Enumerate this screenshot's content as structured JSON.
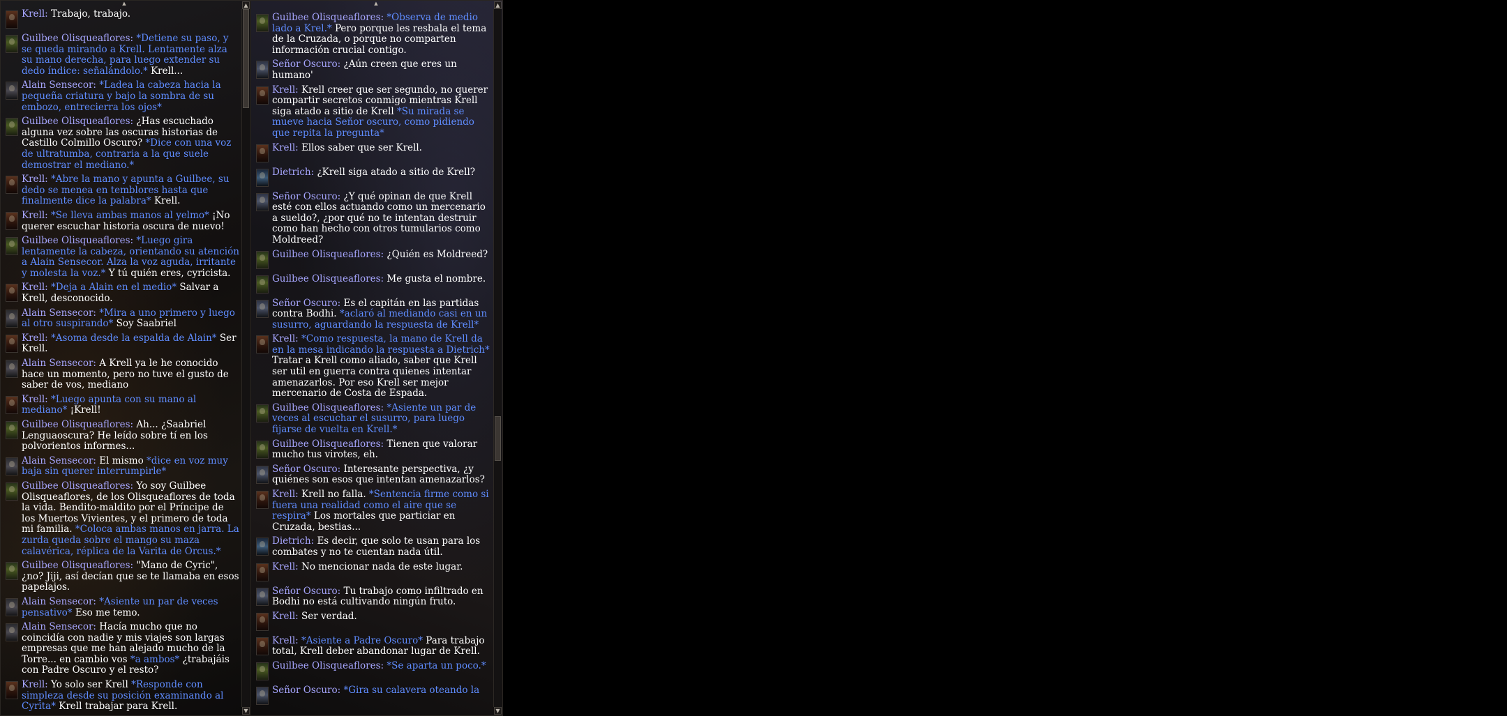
{
  "left_panel": {
    "messages": [
      {
        "speaker": "Krell:",
        "portrait": "krell",
        "parts": [
          {
            "t": "txt",
            "v": "Trabajo, trabajo."
          }
        ]
      },
      {
        "speaker": "Guilbee Olisqueaflores:",
        "portrait": "guilbee",
        "parts": [
          {
            "t": "em",
            "v": "*Detiene su paso, y se queda mirando a Krell. Lentamente alza su mano derecha, para luego extender su dedo índice: señalándolo.*"
          },
          {
            "t": "txt",
            "v": "Krell..."
          }
        ]
      },
      {
        "speaker": "Alain Sensecor:",
        "portrait": "alain",
        "parts": [
          {
            "t": "em",
            "v": "*Ladea la cabeza hacia la pequeña criatura y bajo la sombra de su embozo, entrecierra los ojos*"
          }
        ]
      },
      {
        "speaker": "Guilbee Olisqueaflores:",
        "portrait": "guilbee",
        "parts": [
          {
            "t": "txt",
            "v": "¿Has escuchado alguna vez sobre las oscuras historias de Castillo Colmillo Oscuro?"
          },
          {
            "t": "em",
            "v": "*Dice con una voz de ultratumba, contraria a la que suele demostrar el mediano.*"
          }
        ]
      },
      {
        "speaker": "Krell:",
        "portrait": "krell",
        "parts": [
          {
            "t": "em",
            "v": "*Abre la mano y apunta a Guilbee, su dedo se menea en temblores hasta que finalmente dice la palabra*"
          },
          {
            "t": "txt",
            "v": "Krell."
          }
        ]
      },
      {
        "speaker": "Krell:",
        "portrait": "krell",
        "parts": [
          {
            "t": "em",
            "v": "*Se lleva ambas manos al yelmo*"
          },
          {
            "t": "txt",
            "v": "¡No querer escuchar historia oscura de nuevo!"
          }
        ]
      },
      {
        "speaker": "Guilbee Olisqueaflores:",
        "portrait": "guilbee",
        "parts": [
          {
            "t": "em",
            "v": "*Luego gira lentamente la cabeza, orientando su atención a Alain Sensecor. Alza la voz aguda, irritante y molesta la voz.*"
          },
          {
            "t": "txt",
            "v": "Y tú quién eres, cyricista."
          }
        ]
      },
      {
        "speaker": "Krell:",
        "portrait": "krell",
        "parts": [
          {
            "t": "em",
            "v": "*Deja a Alain en el medio*"
          },
          {
            "t": "txt",
            "v": "Salvar a Krell, desconocido."
          }
        ]
      },
      {
        "speaker": "Alain Sensecor:",
        "portrait": "alain",
        "parts": [
          {
            "t": "em",
            "v": "*Mira a uno primero y luego al otro suspirando*"
          },
          {
            "t": "txt",
            "v": "Soy Saabriel"
          }
        ]
      },
      {
        "speaker": "Krell:",
        "portrait": "krell",
        "parts": [
          {
            "t": "em",
            "v": "*Asoma desde la espalda de Alain*"
          },
          {
            "t": "txt",
            "v": "Ser Krell."
          }
        ]
      },
      {
        "speaker": "Alain Sensecor:",
        "portrait": "alain",
        "parts": [
          {
            "t": "txt",
            "v": "A Krell ya le he conocido hace un momento, pero no tuve el gusto de saber de vos, mediano"
          }
        ]
      },
      {
        "speaker": "Krell:",
        "portrait": "krell",
        "parts": [
          {
            "t": "em",
            "v": "*Luego apunta con su mano al mediano*"
          },
          {
            "t": "txt",
            "v": "¡Krell!"
          }
        ]
      },
      {
        "speaker": "Guilbee Olisqueaflores:",
        "portrait": "guilbee",
        "parts": [
          {
            "t": "txt",
            "v": "Ah... ¿Saabriel Lenguaoscura? He leído sobre tí en los polvorientos informes..."
          }
        ]
      },
      {
        "speaker": "Alain Sensecor:",
        "portrait": "alain",
        "parts": [
          {
            "t": "txt",
            "v": "El mismo"
          },
          {
            "t": "em",
            "v": "*dice en voz muy baja sin querer interrumpirle*"
          }
        ]
      },
      {
        "speaker": "Guilbee Olisqueaflores:",
        "portrait": "guilbee",
        "parts": [
          {
            "t": "txt",
            "v": "Yo soy Guilbee Olisqueaflores, de los Olisqueaflores de toda la vida. Bendito-maldito por el Príncipe de los Muertos Vivientes, y el primero de toda mi familia."
          },
          {
            "t": "em",
            "v": "*Coloca ambas manos en jarra. La zurda queda sobre el mango su maza calavérica, réplica de la Varita de Orcus.*"
          }
        ]
      },
      {
        "speaker": "Guilbee Olisqueaflores:",
        "portrait": "guilbee",
        "parts": [
          {
            "t": "txt",
            "v": "\"Mano de Cyric\", ¿no? Jiji, así decían que se te llamaba en esos papelajos."
          }
        ]
      },
      {
        "speaker": "Alain Sensecor:",
        "portrait": "alain",
        "parts": [
          {
            "t": "em",
            "v": "*Asiente un par de veces pensativo*"
          },
          {
            "t": "txt",
            "v": "Eso me temo."
          }
        ]
      },
      {
        "speaker": "Alain Sensecor:",
        "portrait": "alain",
        "parts": [
          {
            "t": "txt",
            "v": "Hacía mucho que no coincidía con nadie y mis viajes son largas empresas que me han alejado mucho de la Torre... en cambio vos"
          },
          {
            "t": "em",
            "v": "*a ambos*"
          },
          {
            "t": "txt",
            "v": "¿trabajáis con Padre Oscuro y el resto?"
          }
        ]
      },
      {
        "speaker": "Krell:",
        "portrait": "krell",
        "parts": [
          {
            "t": "txt",
            "v": "Yo solo ser Krell"
          },
          {
            "t": "em",
            "v": "*Responde con simpleza desde su posición examinando al Cyrita*"
          },
          {
            "t": "txt",
            "v": "Krell trabajar para Krell."
          }
        ]
      }
    ]
  },
  "right_panel": {
    "messages": [
      {
        "speaker": "Guilbee Olisqueaflores:",
        "portrait": "guilbee",
        "parts": [
          {
            "t": "em",
            "v": "*Observa de medio lado a Krel.*"
          },
          {
            "t": "txt",
            "v": "Pero porque les resbala el tema de la Cruzada, o porque no comparten información crucial contigo."
          }
        ]
      },
      {
        "speaker": "Señor Oscuro:",
        "portrait": "senor",
        "parts": [
          {
            "t": "txt",
            "v": "¿Aún creen que eres un humano'"
          }
        ]
      },
      {
        "speaker": "Krell:",
        "portrait": "krell",
        "parts": [
          {
            "t": "txt",
            "v": "Krell creer que ser segundo, no querer compartir secretos conmigo mientras Krell siga atado a sitio de Krell"
          },
          {
            "t": "em",
            "v": "*Su mirada se mueve hacia Señor oscuro, como pidiendo que repita la pregunta*"
          }
        ]
      },
      {
        "speaker": "Krell:",
        "portrait": "krell",
        "parts": [
          {
            "t": "txt",
            "v": "Ellos saber que ser Krell."
          }
        ]
      },
      {
        "speaker": "Dietrich:",
        "portrait": "dietrich",
        "parts": [
          {
            "t": "txt",
            "v": "¿Krell siga atado a sitio de Krell?"
          }
        ]
      },
      {
        "speaker": "Señor Oscuro:",
        "portrait": "senor",
        "parts": [
          {
            "t": "txt",
            "v": "¿Y qué opinan de que Krell esté con ellos actuando como un mercenario a sueldo?, ¿por qué no te intentan destruir como han hecho con otros tumularios como Moldreed?"
          }
        ]
      },
      {
        "speaker": "Guilbee Olisqueaflores:",
        "portrait": "guilbee",
        "parts": [
          {
            "t": "txt",
            "v": "¿Quién es Moldreed?"
          }
        ]
      },
      {
        "speaker": "Guilbee Olisqueaflores:",
        "portrait": "guilbee",
        "parts": [
          {
            "t": "txt",
            "v": "Me gusta el nombre."
          }
        ]
      },
      {
        "speaker": "Señor Oscuro:",
        "portrait": "senor",
        "parts": [
          {
            "t": "txt",
            "v": "Es el capitán en las partidas contra Bodhi."
          },
          {
            "t": "em",
            "v": "*aclaró al mediando casi en un susurro, aguardando la respuesta de Krell*"
          }
        ]
      },
      {
        "speaker": "Krell:",
        "portrait": "krell",
        "parts": [
          {
            "t": "em",
            "v": "*Como respuesta, la mano de Krell da en la mesa indicando la respuesta a Dietrich*"
          },
          {
            "t": "txt",
            "v": "Tratar a Krell como aliado, saber que Krell ser util en guerra contra quienes intentar amenazarlos. Por eso Krell ser mejor mercenario de Costa de Espada."
          }
        ]
      },
      {
        "speaker": "Guilbee Olisqueaflores:",
        "portrait": "guilbee",
        "parts": [
          {
            "t": "em",
            "v": "*Asiente un par de veces al escuchar el susurro, para luego fijarse de vuelta en Krell.*"
          }
        ]
      },
      {
        "speaker": "Guilbee Olisqueaflores:",
        "portrait": "guilbee",
        "parts": [
          {
            "t": "txt",
            "v": "Tienen que valorar mucho tus virotes, eh."
          }
        ]
      },
      {
        "speaker": "Señor Oscuro:",
        "portrait": "senor",
        "parts": [
          {
            "t": "txt",
            "v": "Interesante perspectiva, ¿y quiénes son esos que intentan amenazarlos?"
          }
        ]
      },
      {
        "speaker": "Krell:",
        "portrait": "krell",
        "parts": [
          {
            "t": "txt",
            "v": "Krell no falla."
          },
          {
            "t": "em",
            "v": "*Sentencia firme como si fuera una realidad como el aire que se respira*"
          },
          {
            "t": "txt",
            "v": "Los mortales que particiar en Cruzada, bestias..."
          }
        ]
      },
      {
        "speaker": "Dietrich:",
        "portrait": "dietrich",
        "parts": [
          {
            "t": "txt",
            "v": "Es decir, que solo te usan para los combates y no te cuentan nada útil."
          }
        ]
      },
      {
        "speaker": "Krell:",
        "portrait": "krell",
        "parts": [
          {
            "t": "txt",
            "v": "No mencionar nada de este lugar."
          }
        ]
      },
      {
        "speaker": "Señor Oscuro:",
        "portrait": "senor",
        "parts": [
          {
            "t": "txt",
            "v": "Tu trabajo como infiltrado en Bodhi no está cultivando ningún fruto."
          }
        ]
      },
      {
        "speaker": "Krell:",
        "portrait": "krell",
        "parts": [
          {
            "t": "txt",
            "v": "Ser verdad."
          }
        ]
      },
      {
        "speaker": "Krell:",
        "portrait": "krell",
        "parts": [
          {
            "t": "em",
            "v": "*Asiente a Padre Oscuro*"
          },
          {
            "t": "txt",
            "v": "Para trabajo total, Krell deber abandonar lugar de Krell."
          }
        ]
      },
      {
        "speaker": "Guilbee Olisqueaflores:",
        "portrait": "guilbee",
        "parts": [
          {
            "t": "em",
            "v": "*Se aparta un poco.*"
          }
        ]
      },
      {
        "speaker": "Señor Oscuro:",
        "portrait": "senor",
        "parts": [
          {
            "t": "em",
            "v": "*Gira su calavera oteando la"
          }
        ]
      }
    ]
  },
  "scroll_icons": {
    "up": "▲",
    "down": "▼"
  }
}
